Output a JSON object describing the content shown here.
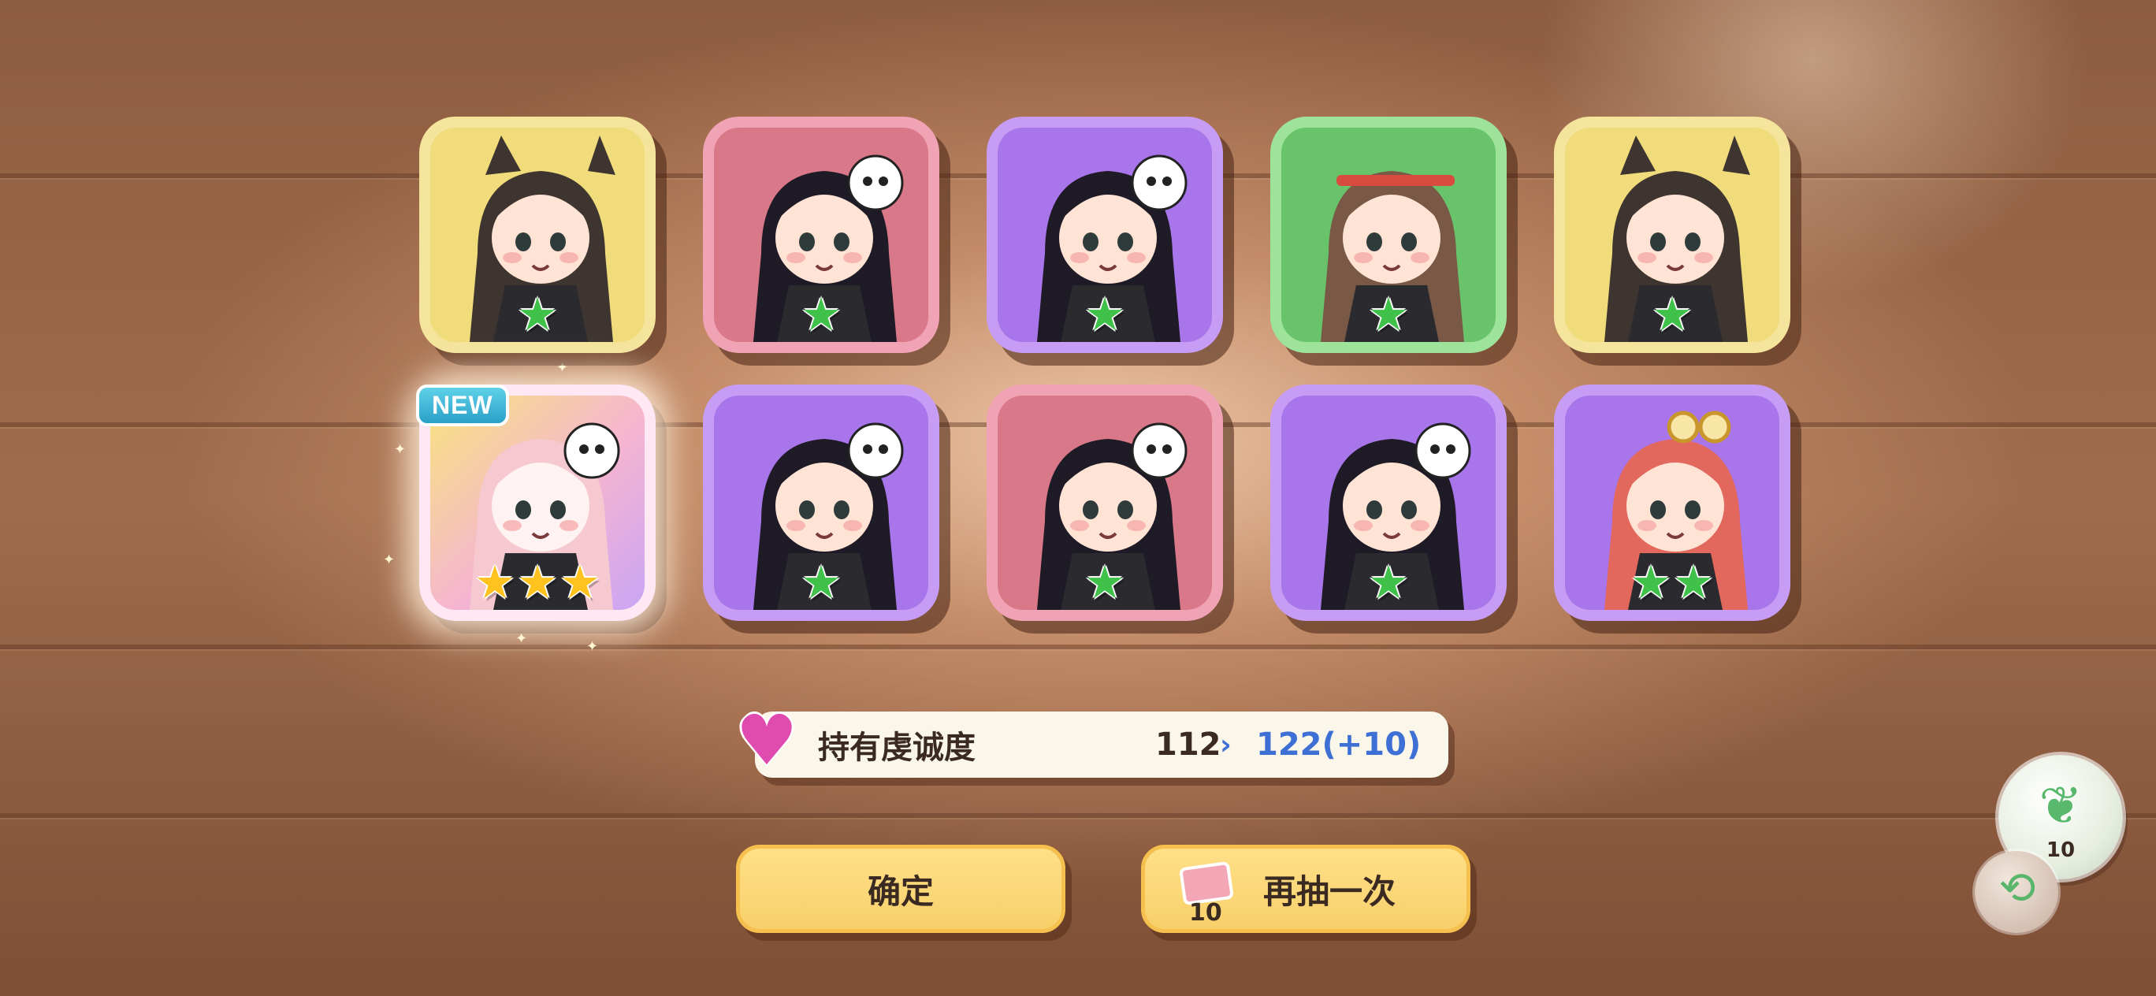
{
  "results": {
    "cards": [
      {
        "id": "c1",
        "frame": "yellow",
        "portrait": "wolf-girl",
        "stars": 1,
        "star_color": "green"
      },
      {
        "id": "c2",
        "frame": "pink",
        "portrait": "skull-girl",
        "stars": 1,
        "star_color": "green"
      },
      {
        "id": "c3",
        "frame": "purple",
        "portrait": "skull-girl",
        "stars": 1,
        "star_color": "green"
      },
      {
        "id": "c4",
        "frame": "green",
        "portrait": "headband-girl",
        "stars": 1,
        "star_color": "green"
      },
      {
        "id": "c5",
        "frame": "yellow",
        "portrait": "wolf-girl",
        "stars": 1,
        "star_color": "green"
      },
      {
        "id": "c6",
        "frame": "rainbow",
        "portrait": "pink-hair-girl",
        "stars": 3,
        "star_color": "gold",
        "is_new": true
      },
      {
        "id": "c7",
        "frame": "purple",
        "portrait": "skull-girl",
        "stars": 1,
        "star_color": "green"
      },
      {
        "id": "c8",
        "frame": "pink",
        "portrait": "skull-girl",
        "stars": 1,
        "star_color": "green"
      },
      {
        "id": "c9",
        "frame": "purple",
        "portrait": "skull-girl",
        "stars": 1,
        "star_color": "green"
      },
      {
        "id": "c10",
        "frame": "purple",
        "portrait": "goggles-girl",
        "stars": 2,
        "star_color": "green"
      }
    ],
    "new_badge": "NEW"
  },
  "loyalty": {
    "label": "持有虔诚度",
    "current": "112",
    "arrow": "›",
    "new_value": "122(+10)",
    "icon": "heart-icon"
  },
  "buttons": {
    "confirm": "确定",
    "draw_again": "再抽一次",
    "draw_again_cost": "10"
  },
  "side": {
    "bubble_count": "10",
    "bubble_icon": "leaf-icon",
    "small_icon": "share-icon"
  },
  "colors": {
    "star_green": "#3fc14a",
    "star_gold": "#ffc21f",
    "loyalty_value": "#3d6fd4",
    "button": "#f8d06a"
  }
}
